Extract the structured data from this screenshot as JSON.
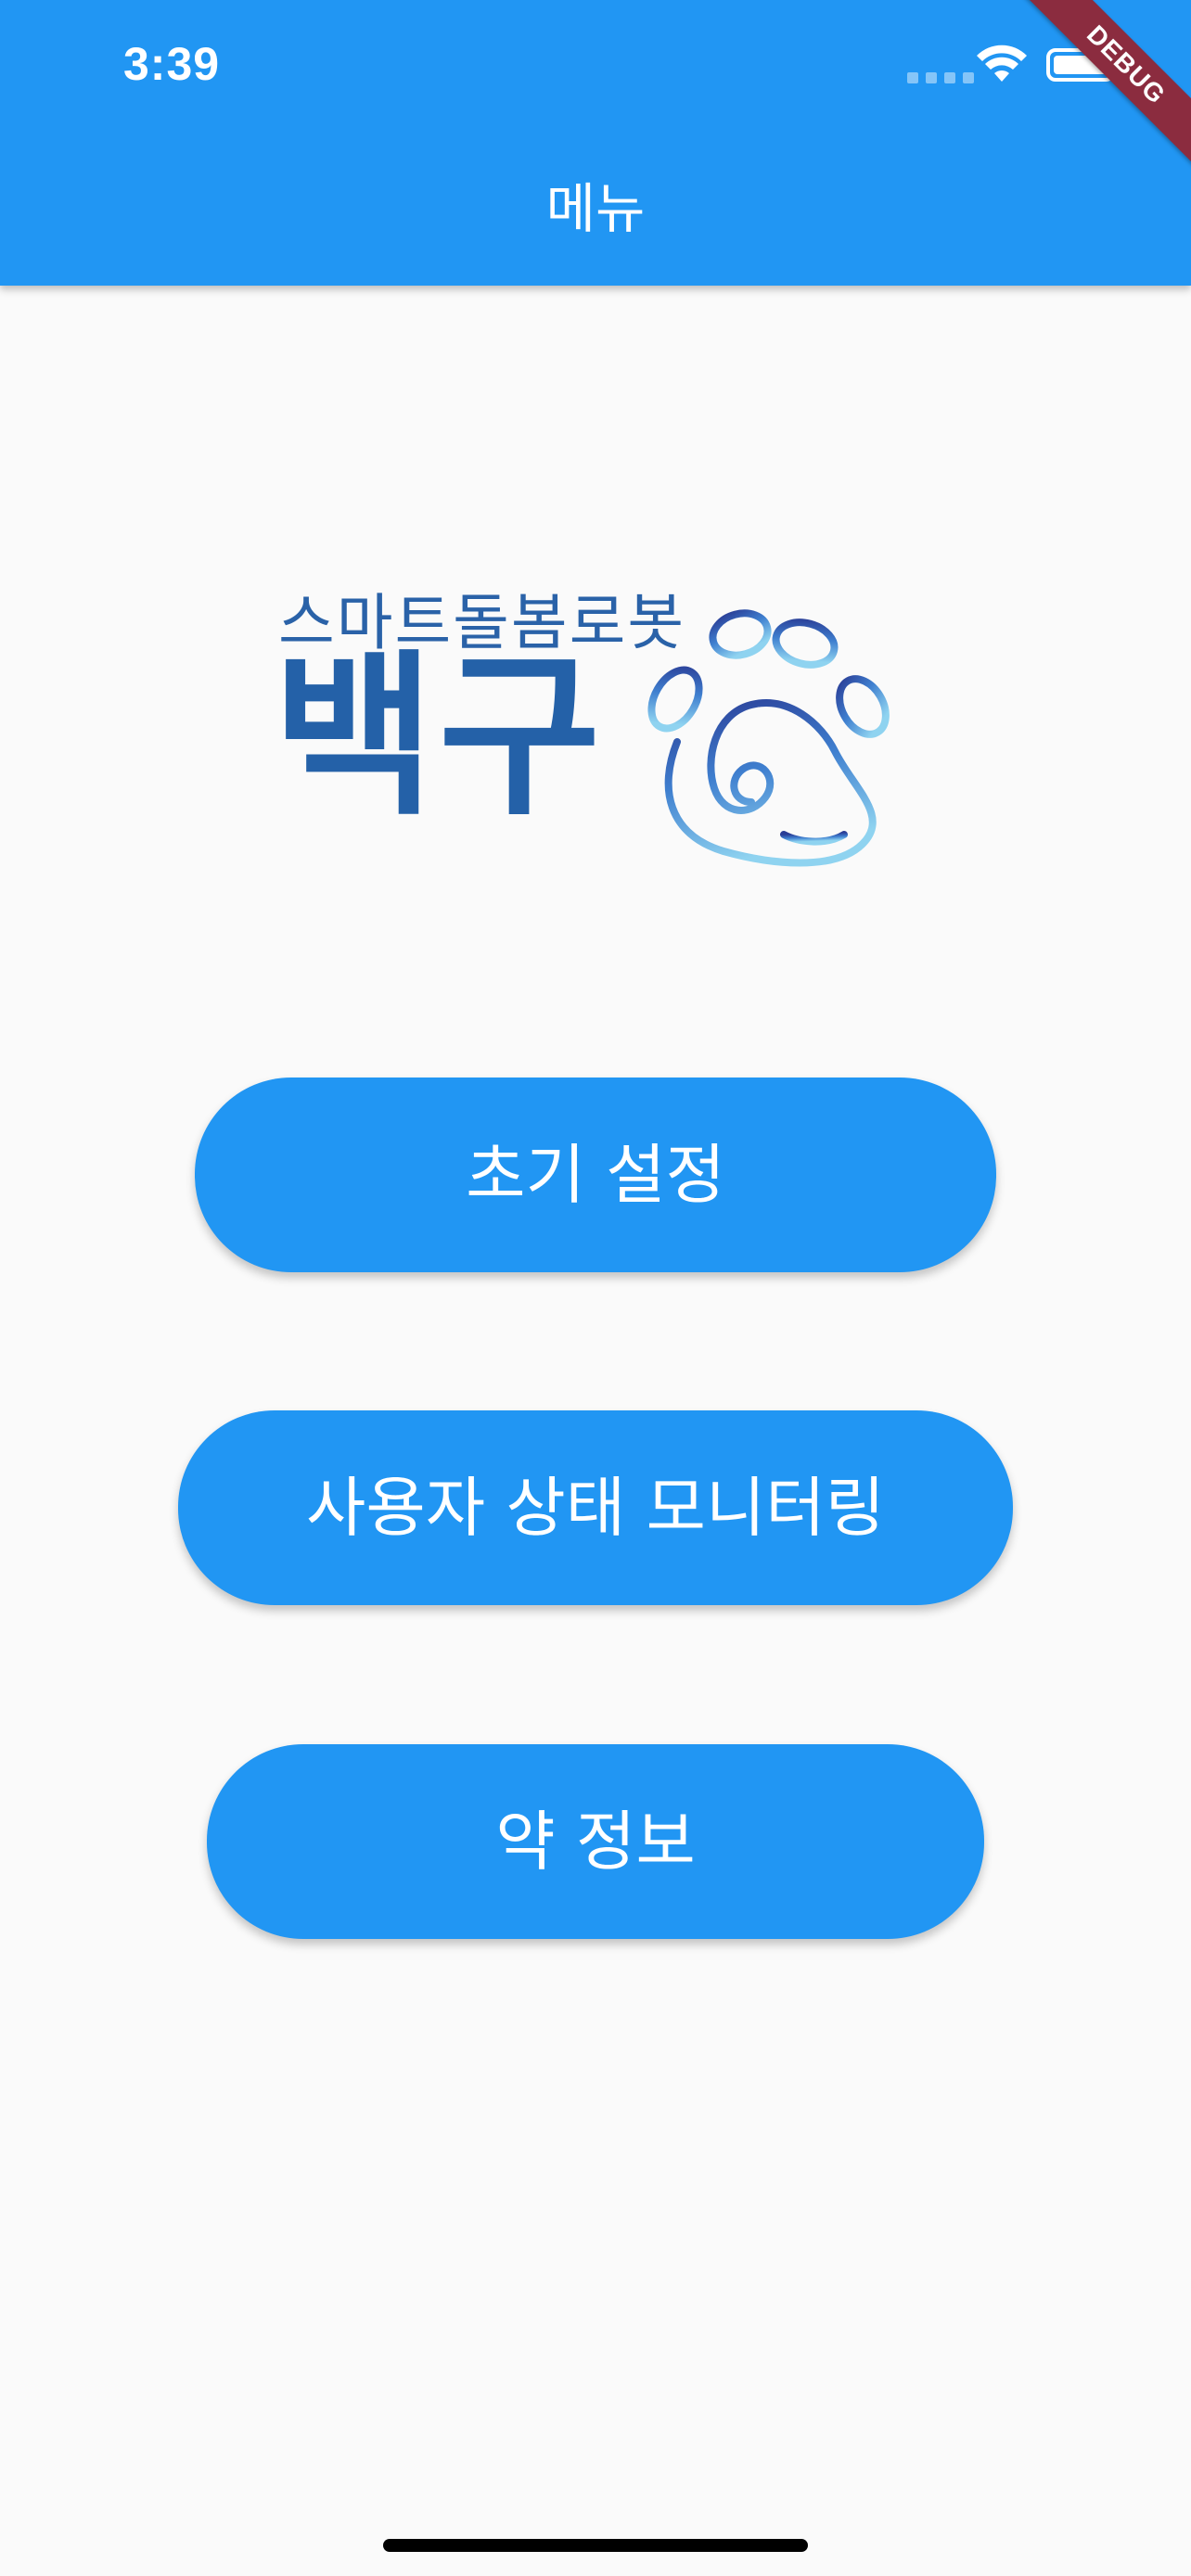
{
  "status_bar": {
    "time": "3:39"
  },
  "app_bar": {
    "title": "메뉴",
    "background_color": "#2196f3"
  },
  "debug_banner": {
    "label": "DEBUG",
    "color": "#8b2c3f"
  },
  "logo": {
    "subtitle": "스마트돌봄로봇",
    "title": "백구",
    "icon": "paw-icon",
    "color": "#2461a8"
  },
  "menu": {
    "buttons": [
      {
        "label": "초기 설정"
      },
      {
        "label": "사용자 상태 모니터링"
      },
      {
        "label": "약 정보"
      }
    ],
    "button_color": "#2196f3"
  },
  "icons": {
    "wifi": "wifi-icon",
    "battery": "battery-icon",
    "signal": "signal-icon"
  }
}
